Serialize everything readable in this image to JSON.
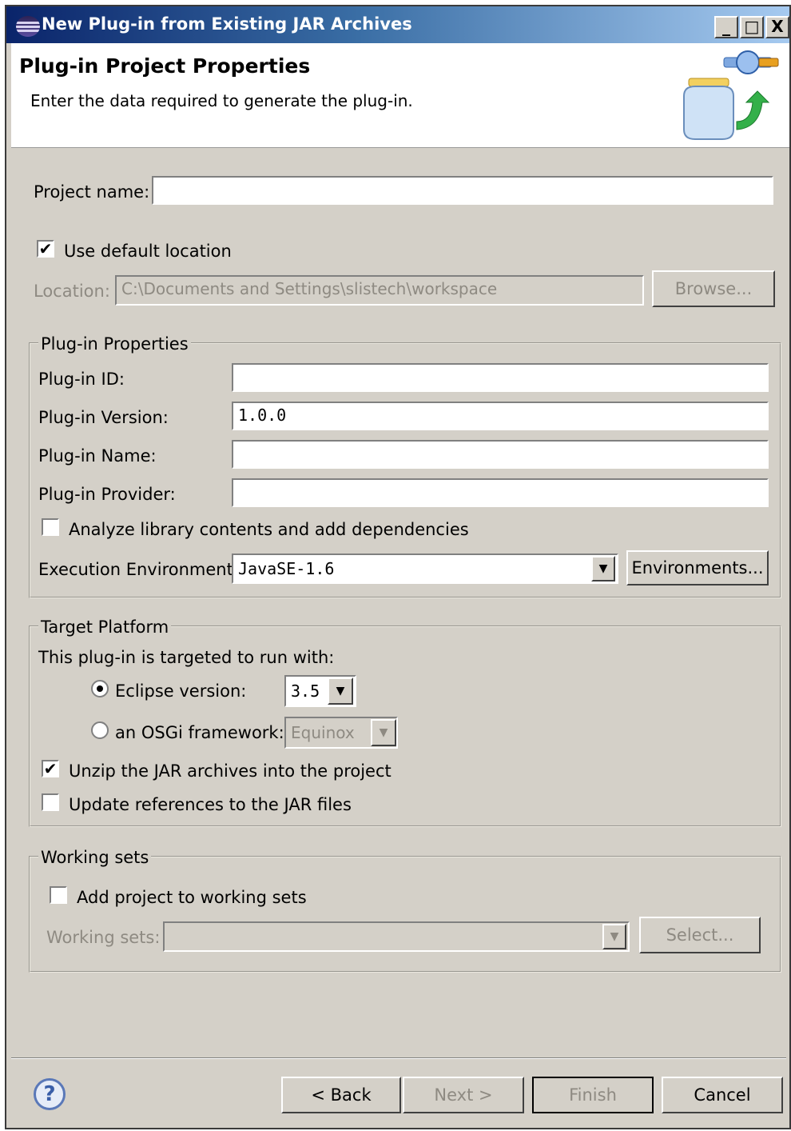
{
  "window": {
    "title": "New Plug-in from Existing JAR Archives",
    "controls": [
      "_",
      "□",
      "X"
    ]
  },
  "header": {
    "title": "Plug-in Project Properties",
    "description": "Enter the data required to generate the plug-in."
  },
  "project": {
    "name_label": "Project name:",
    "name_value": "",
    "use_default_location_label": "Use default location",
    "use_default_location_checked": true,
    "location_label": "Location:",
    "location_value": "C:\\Documents and Settings\\slistech\\workspace",
    "browse_label": "Browse..."
  },
  "plugin_properties": {
    "group_label": "Plug-in Properties",
    "id_label": "Plug-in ID:",
    "id_value": "",
    "version_label": "Plug-in Version:",
    "version_value": "1.0.0",
    "name_label": "Plug-in Name:",
    "name_value": "",
    "provider_label": "Plug-in Provider:",
    "provider_value": "",
    "analyze_label": "Analyze library contents and add dependencies",
    "analyze_checked": false,
    "exec_env_label": "Execution Environment:",
    "exec_env_value": "JavaSE-1.6",
    "environments_label": "Environments..."
  },
  "target_platform": {
    "group_label": "Target Platform",
    "intro": "This plug-in is targeted to run with:",
    "eclipse_label": "Eclipse version:",
    "eclipse_selected": true,
    "eclipse_version": "3.5",
    "osgi_label": "an OSGi framework:",
    "osgi_value": "Equinox",
    "unzip_label": "Unzip the JAR archives into the project",
    "unzip_checked": true,
    "update_refs_label": "Update references to the JAR files",
    "update_refs_checked": false
  },
  "working_sets": {
    "group_label": "Working sets",
    "add_label": "Add project to working sets",
    "add_checked": false,
    "sets_label": "Working sets:",
    "sets_value": "",
    "select_label": "Select..."
  },
  "buttons": {
    "back": "< Back",
    "next": "Next >",
    "finish": "Finish",
    "cancel": "Cancel",
    "help": "?"
  },
  "icons": {
    "window_icon": "eclipse-icon",
    "wizard_banner": "jar-plugin-icon",
    "help": "help-icon"
  }
}
